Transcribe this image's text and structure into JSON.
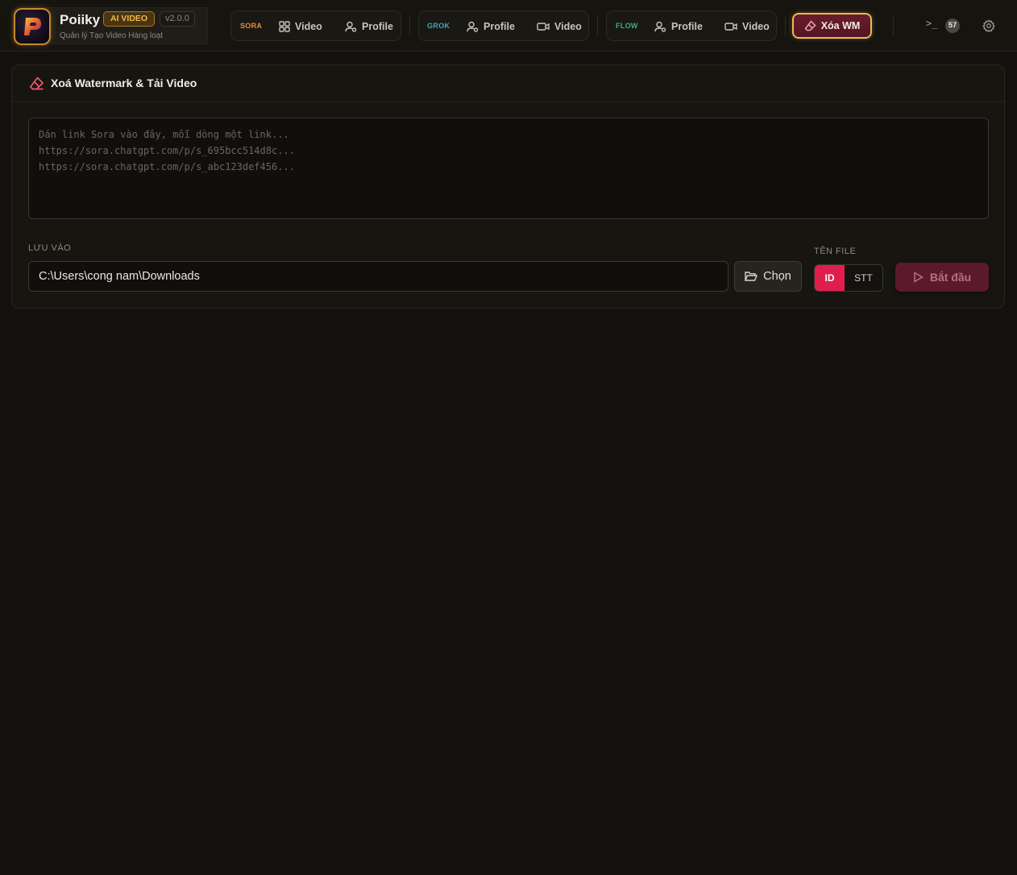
{
  "brand": {
    "name": "Poiiky",
    "badge": "AI VIDEO",
    "version": "v2.0.0",
    "subtitle": "Quản lý Tạo Video Hàng loạt"
  },
  "nav": {
    "sora": {
      "label": "SORA",
      "color": "#e58f3c",
      "video": "Video",
      "profile": "Profile"
    },
    "grok": {
      "label": "GROK",
      "color": "#3ba7c9",
      "profile": "Profile",
      "video": "Video"
    },
    "flow": {
      "label": "FLOW",
      "color": "#32b86d",
      "profile": "Profile",
      "video": "Video"
    },
    "remove_wm": "Xóa WM",
    "terminal_glyph": ">_",
    "log_count": "57"
  },
  "panel": {
    "title": "Xoá Watermark & Tải Video",
    "links_placeholder": "Dán link Sora vào đây, mỗi dòng một link...\nhttps://sora.chatgpt.com/p/s_695bcc514d8c...\nhttps://sora.chatgpt.com/p/s_abc123def456...",
    "save_label": "LƯU VÀO",
    "save_path": "C:\\Users\\cong nam\\Downloads",
    "choose_label": "Chọn",
    "filename_label": "TÊN FILE",
    "filename_options": [
      "ID",
      "STT"
    ],
    "start_label": "Bắt đầu"
  },
  "colors": {
    "accent_pink": "#e01e4e",
    "gold": "#e9b85a",
    "background": "#12110e"
  }
}
